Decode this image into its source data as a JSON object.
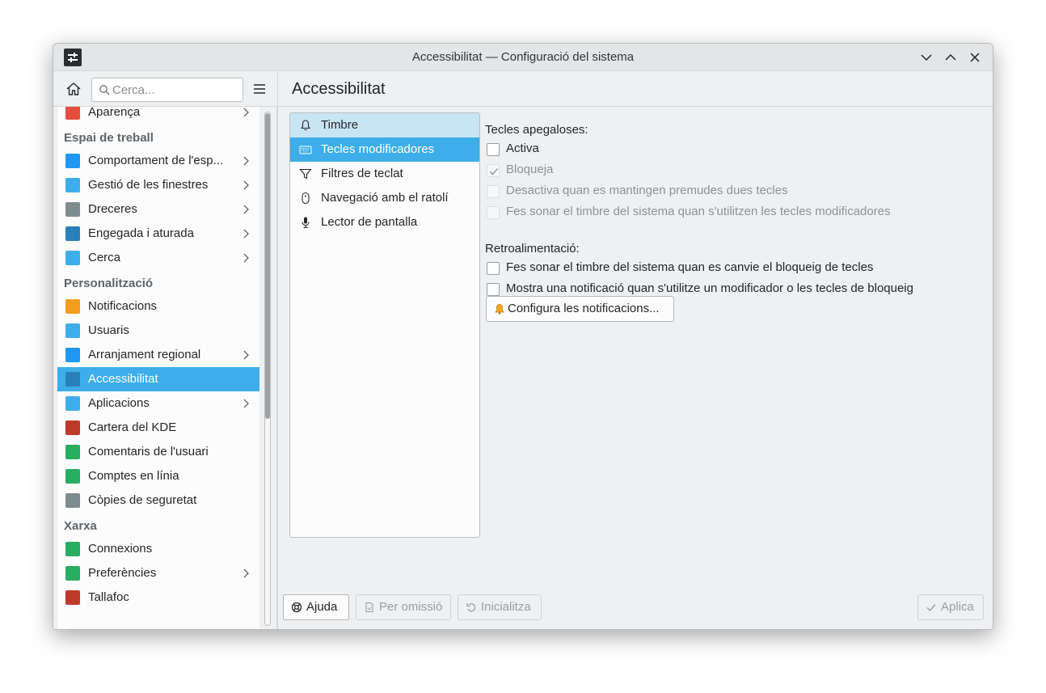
{
  "window": {
    "title": "Accessibilitat — Configuració del sistema"
  },
  "search": {
    "placeholder": "Cerca..."
  },
  "header": {
    "title": "Accessibilitat"
  },
  "sidebar": {
    "items": [
      {
        "type": "item",
        "label": "Aparença",
        "icon": "appearance-icon",
        "color": "#e74c3c",
        "chevron": true
      },
      {
        "type": "section",
        "label": "Espai de treball"
      },
      {
        "type": "item",
        "label": "Comportament de l'esp...",
        "icon": "workspace-behavior-icon",
        "color": "#1d99f3",
        "chevron": true
      },
      {
        "type": "item",
        "label": "Gestió de les finestres",
        "icon": "window-management-icon",
        "color": "#3daee9",
        "chevron": true
      },
      {
        "type": "item",
        "label": "Dreceres",
        "icon": "keyboard-shortcuts-icon",
        "color": "#7f8c8d",
        "chevron": true
      },
      {
        "type": "item",
        "label": "Engegada i aturada",
        "icon": "startup-shutdown-icon",
        "color": "#2980b9",
        "chevron": true
      },
      {
        "type": "item",
        "label": "Cerca",
        "icon": "search-settings-icon",
        "color": "#3daee9",
        "chevron": true
      },
      {
        "type": "section",
        "label": "Personalització"
      },
      {
        "type": "item",
        "label": "Notificacions",
        "icon": "bell-icon",
        "color": "#f39c1f",
        "chevron": false
      },
      {
        "type": "item",
        "label": "Usuaris",
        "icon": "users-icon",
        "color": "#3daee9",
        "chevron": false
      },
      {
        "type": "item",
        "label": "Arranjament regional",
        "icon": "regional-settings-icon",
        "color": "#1d99f3",
        "chevron": true
      },
      {
        "type": "item",
        "label": "Accessibilitat",
        "icon": "accessibility-icon",
        "color": "#2980b9",
        "chevron": false,
        "active": true
      },
      {
        "type": "item",
        "label": "Aplicacions",
        "icon": "applications-icon",
        "color": "#3daee9",
        "chevron": true
      },
      {
        "type": "item",
        "label": "Cartera del KDE",
        "icon": "kde-wallet-icon",
        "color": "#c0392b",
        "chevron": false
      },
      {
        "type": "item",
        "label": "Comentaris de l'usuari",
        "icon": "user-feedback-icon",
        "color": "#27ae60",
        "chevron": false
      },
      {
        "type": "item",
        "label": "Comptes en línia",
        "icon": "online-accounts-icon",
        "color": "#27ae60",
        "chevron": false
      },
      {
        "type": "item",
        "label": "Còpies de seguretat",
        "icon": "backup-icon",
        "color": "#7f8c8d",
        "chevron": false
      },
      {
        "type": "section",
        "label": "Xarxa"
      },
      {
        "type": "item",
        "label": "Connexions",
        "icon": "connections-icon",
        "color": "#27ae60",
        "chevron": false
      },
      {
        "type": "item",
        "label": "Preferències",
        "icon": "network-preferences-icon",
        "color": "#27ae60",
        "chevron": true
      },
      {
        "type": "item",
        "label": "Tallafoc",
        "icon": "firewall-icon",
        "color": "#c0392b",
        "chevron": false
      }
    ]
  },
  "categories": [
    {
      "label": "Timbre",
      "icon": "bell-outline-icon",
      "state": "hover"
    },
    {
      "label": "Tecles modificadores",
      "icon": "keyboard-icon",
      "state": "selected"
    },
    {
      "label": "Filtres de teclat",
      "icon": "filter-icon",
      "state": ""
    },
    {
      "label": "Navegació amb el ratolí",
      "icon": "mouse-icon",
      "state": ""
    },
    {
      "label": "Lector de pantalla",
      "icon": "microphone-icon",
      "state": ""
    }
  ],
  "sticky": {
    "title": "Tecles apegaloses:",
    "options": [
      {
        "label": "Activa",
        "checked": false,
        "disabled": false
      },
      {
        "label": "Bloqueja",
        "checked": true,
        "disabled": true
      },
      {
        "label": "Desactiva quan es mantingen premudes dues tecles",
        "checked": false,
        "disabled": true
      },
      {
        "label": "Fes sonar el timbre del sistema quan s'utilitzen les tecles modificadores",
        "checked": false,
        "disabled": true
      }
    ]
  },
  "feedback": {
    "title": "Retroalimentació:",
    "options": [
      {
        "label": "Fes sonar el timbre del sistema quan es canvie el bloqueig de tecles",
        "checked": false,
        "disabled": false
      },
      {
        "label": "Mostra una notificació quan s'utilitze un modificador o les tecles de bloqueig",
        "checked": false,
        "disabled": false
      }
    ],
    "configure_button": "Configura les notificacions..."
  },
  "footer": {
    "help": "Ajuda",
    "defaults": "Per omissió",
    "reset": "Inicialitza",
    "apply": "Aplica"
  },
  "colors": {
    "accent": "#3daee9",
    "hover": "#c8e5f6"
  }
}
